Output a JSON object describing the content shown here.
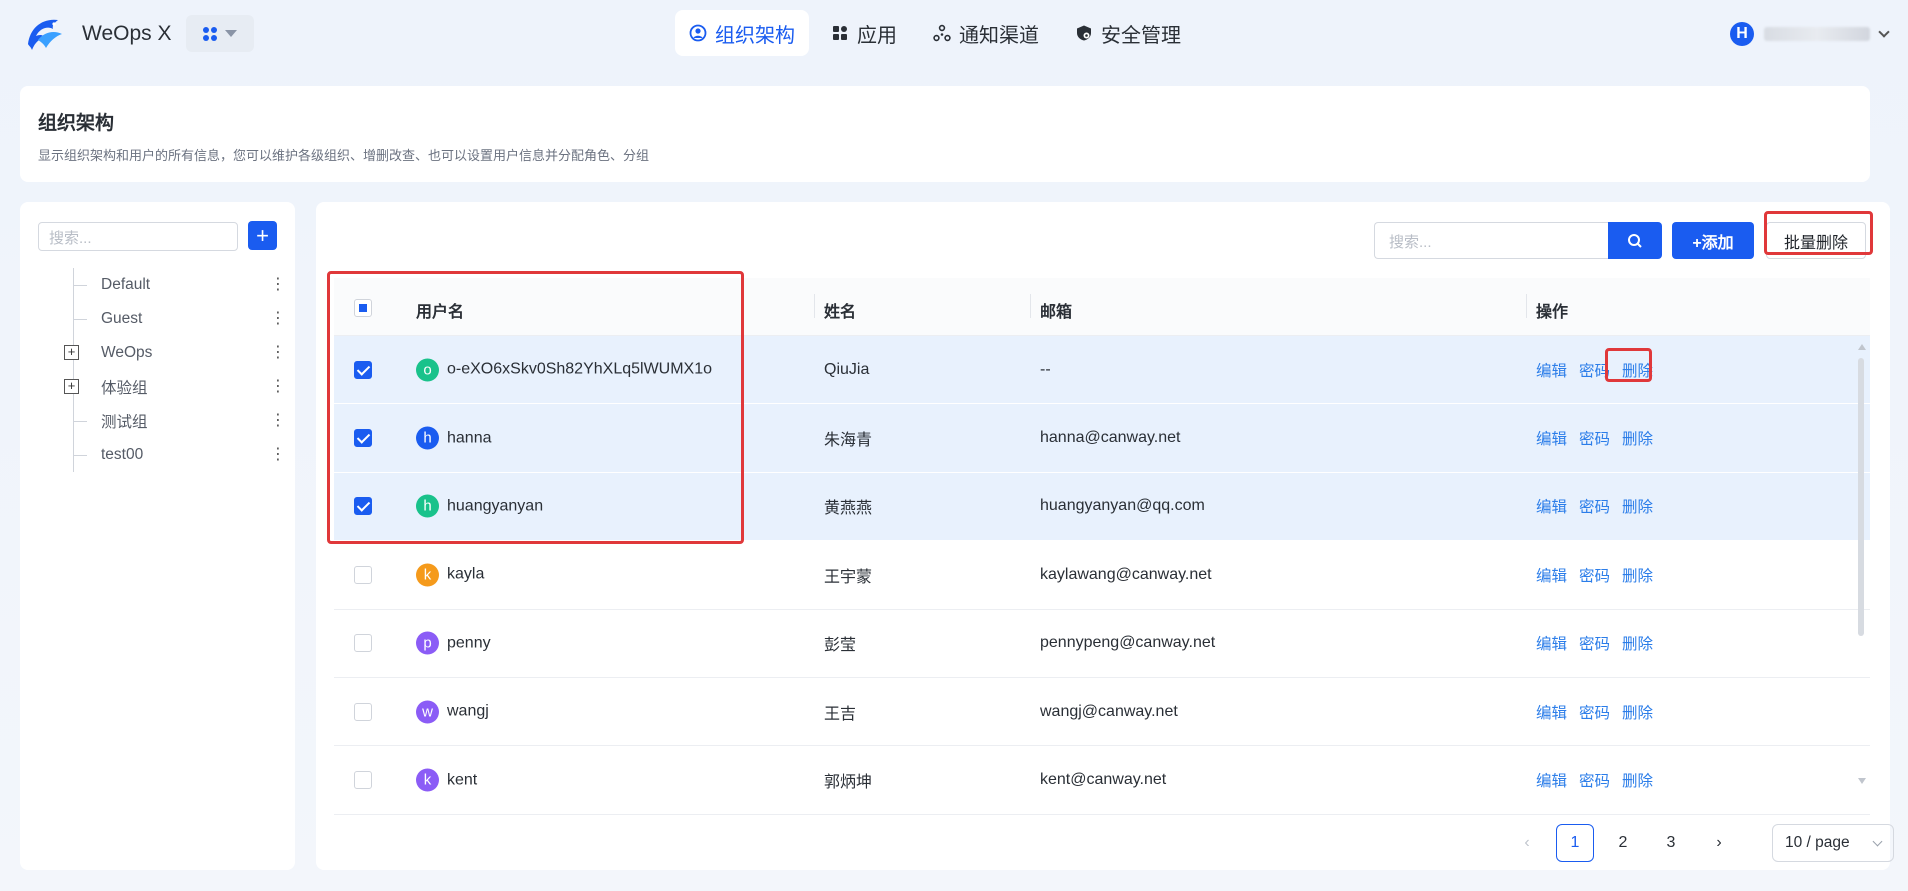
{
  "app": {
    "title": "WeOps X"
  },
  "nav": [
    {
      "label": "组织架构",
      "icon": "user-circle-icon",
      "active": true
    },
    {
      "label": "应用",
      "icon": "apps-icon",
      "active": false
    },
    {
      "label": "通知渠道",
      "icon": "share-nodes-icon",
      "active": false
    },
    {
      "label": "安全管理",
      "icon": "shield-gear-icon",
      "active": false
    }
  ],
  "user": {
    "initial": "H"
  },
  "header": {
    "title": "组织架构",
    "description": "显示组织架构和用户的所有信息，您可以维护各级组织、增删改查、也可以设置用户信息并分配角色、分组"
  },
  "tree": {
    "search_placeholder": "搜索...",
    "add_label": "+",
    "items": [
      {
        "label": "Default",
        "expandable": false
      },
      {
        "label": "Guest",
        "expandable": false
      },
      {
        "label": "WeOps",
        "expandable": true
      },
      {
        "label": "体验组",
        "expandable": true
      },
      {
        "label": "测试组",
        "expandable": false
      },
      {
        "label": "test00",
        "expandable": false
      }
    ],
    "more_glyph": "⋮",
    "expand_glyph": "+"
  },
  "toolbar": {
    "search_placeholder": "搜索...",
    "add_label": "+添加",
    "bulk_delete_label": "批量删除"
  },
  "table": {
    "columns": {
      "username": "用户名",
      "name": "姓名",
      "email": "邮箱",
      "actions": "操作"
    },
    "action_labels": {
      "edit": "编辑",
      "password": "密码",
      "delete": "删除"
    },
    "rows": [
      {
        "avatar": "o",
        "avatar_color": "#19c28b",
        "username": "o-eXO6xSkv0Sh82YhXLq5lWUMX1o",
        "name": "QiuJia",
        "email": "--",
        "checked": true
      },
      {
        "avatar": "h",
        "avatar_color": "#1a5cf0",
        "username": "hanna",
        "name": "朱海青",
        "email": "hanna@canway.net",
        "checked": true
      },
      {
        "avatar": "h",
        "avatar_color": "#19c28b",
        "username": "huangyanyan",
        "name": "黄燕燕",
        "email": "huangyanyan@qq.com",
        "checked": true
      },
      {
        "avatar": "k",
        "avatar_color": "#f59a1b",
        "username": "kayla",
        "name": "王宇蒙",
        "email": "kaylawang@canway.net",
        "checked": false
      },
      {
        "avatar": "p",
        "avatar_color": "#8b5cf6",
        "username": "penny",
        "name": "彭莹",
        "email": "pennypeng@canway.net",
        "checked": false
      },
      {
        "avatar": "w",
        "avatar_color": "#8b5cf6",
        "username": "wangj",
        "name": "王吉",
        "email": "wangj@canway.net",
        "checked": false
      },
      {
        "avatar": "k",
        "avatar_color": "#8b5cf6",
        "username": "kent",
        "name": "郭炳坤",
        "email": "kent@canway.net",
        "checked": false
      }
    ]
  },
  "pagination": {
    "prev": "‹",
    "next": "›",
    "pages": [
      "1",
      "2",
      "3"
    ],
    "current": "1",
    "page_size": "10 / page"
  },
  "colors": {
    "primary": "#1a5cf0",
    "link": "#2b7de9",
    "highlight": "#e0383a",
    "selected_row": "#e8f1fd"
  }
}
